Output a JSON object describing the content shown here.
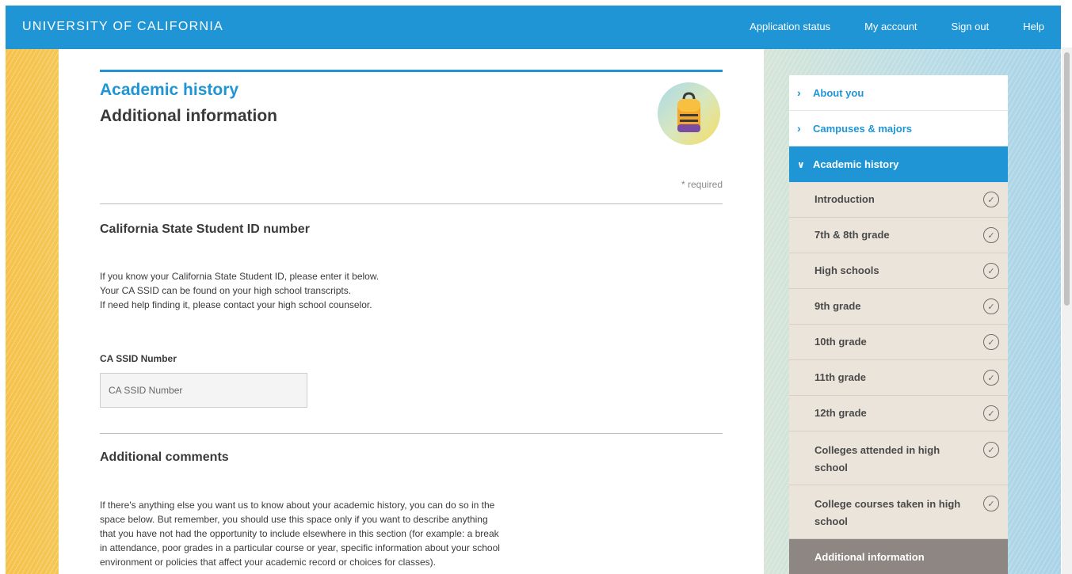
{
  "header": {
    "brand": "UNIVERSITY OF CALIFORNIA",
    "nav": [
      "Application status",
      "My account",
      "Sign out",
      "Help"
    ]
  },
  "page": {
    "section_title": "Academic history",
    "subtitle": "Additional information",
    "required_note": "* required",
    "icon": "backpack-icon"
  },
  "ssid": {
    "heading": "California State Student ID number",
    "lines": [
      "If you know your California State Student ID, please enter it below.",
      "Your CA SSID can be found on your high school transcripts.",
      "If need help finding it, please contact your high school counselor."
    ],
    "field_label": "CA SSID Number",
    "placeholder": "CA SSID Number",
    "value": ""
  },
  "comments": {
    "heading": "Additional comments",
    "lines": [
      "If there's anything else you want us to know about your academic history, you can do so in the",
      "space below. But remember, you should use this space only if you want to describe anything",
      "that you have not had the opportunity to include elsewhere in this section (for example: a break",
      "in attendance, poor grades in a particular course or year, specific information about your school",
      "environment or policies that affect your academic record or choices for classes)."
    ]
  },
  "sidebar": {
    "top_items": [
      {
        "label": "About you",
        "icon": "chevron-right-icon"
      },
      {
        "label": "Campuses & majors",
        "icon": "chevron-right-icon"
      }
    ],
    "active": {
      "label": "Academic history",
      "icon": "chevron-down-icon"
    },
    "sub_items": [
      {
        "label": "Introduction",
        "status": "complete"
      },
      {
        "label": "7th & 8th grade",
        "status": "complete"
      },
      {
        "label": "High schools",
        "status": "complete"
      },
      {
        "label": "9th grade",
        "status": "complete"
      },
      {
        "label": "10th grade",
        "status": "complete"
      },
      {
        "label": "11th grade",
        "status": "complete"
      },
      {
        "label": "12th grade",
        "status": "complete"
      },
      {
        "label": "Colleges attended in high school",
        "status": "complete"
      },
      {
        "label": "College courses taken in high school",
        "status": "complete"
      }
    ],
    "current": "Additional information"
  },
  "colors": {
    "accent": "#1f95d6",
    "sidebar_sub_bg": "#ebe4db",
    "sidebar_current_bg": "#8d8682"
  }
}
